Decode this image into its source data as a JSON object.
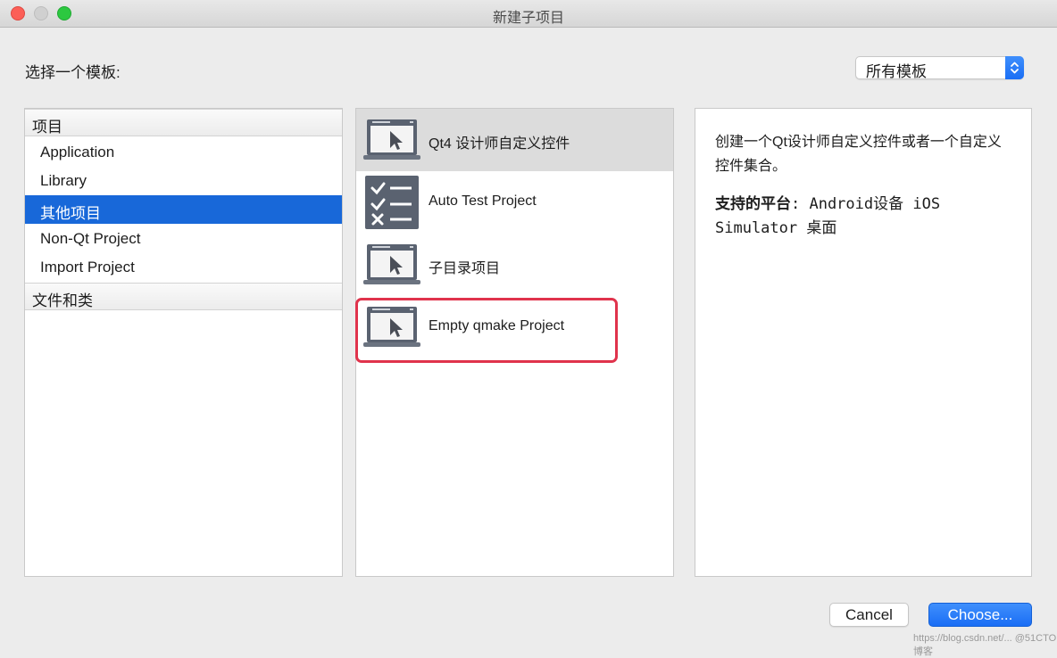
{
  "window": {
    "title": "新建子项目"
  },
  "header": {
    "choose_label": "选择一个模板:",
    "filter_select": {
      "value": "所有模板"
    }
  },
  "categories": {
    "group1": "项目",
    "items": [
      {
        "label": "Application",
        "selected": false
      },
      {
        "label": "Library",
        "selected": false
      },
      {
        "label": "其他项目",
        "selected": true
      },
      {
        "label": "Non-Qt Project",
        "selected": false
      },
      {
        "label": "Import Project",
        "selected": false
      }
    ],
    "group2": "文件和类"
  },
  "templates": [
    {
      "label": "Qt4 设计师自定义控件",
      "icon": "monitor-cursor-icon",
      "selected": true
    },
    {
      "label": "Auto Test Project",
      "icon": "checklist-icon",
      "selected": false
    },
    {
      "label": "子目录项目",
      "icon": "monitor-cursor-icon",
      "selected": false
    },
    {
      "label": "Empty qmake Project",
      "icon": "monitor-cursor-icon",
      "selected": false,
      "highlighted": true
    }
  ],
  "description": {
    "text": "创建一个Qt设计师自定义控件或者一个自定义控件集合。",
    "platforms_label": "支持的平台",
    "platforms_value": ": Android设备 iOS Simulator 桌面"
  },
  "buttons": {
    "cancel": "Cancel",
    "choose": "Choose..."
  },
  "watermark": "https://blog.csdn.net/...  @51CTO博客",
  "colors": {
    "accent": "#1868d9",
    "highlight_border": "#e0334c",
    "selection_grey": "#dcdcdc"
  }
}
